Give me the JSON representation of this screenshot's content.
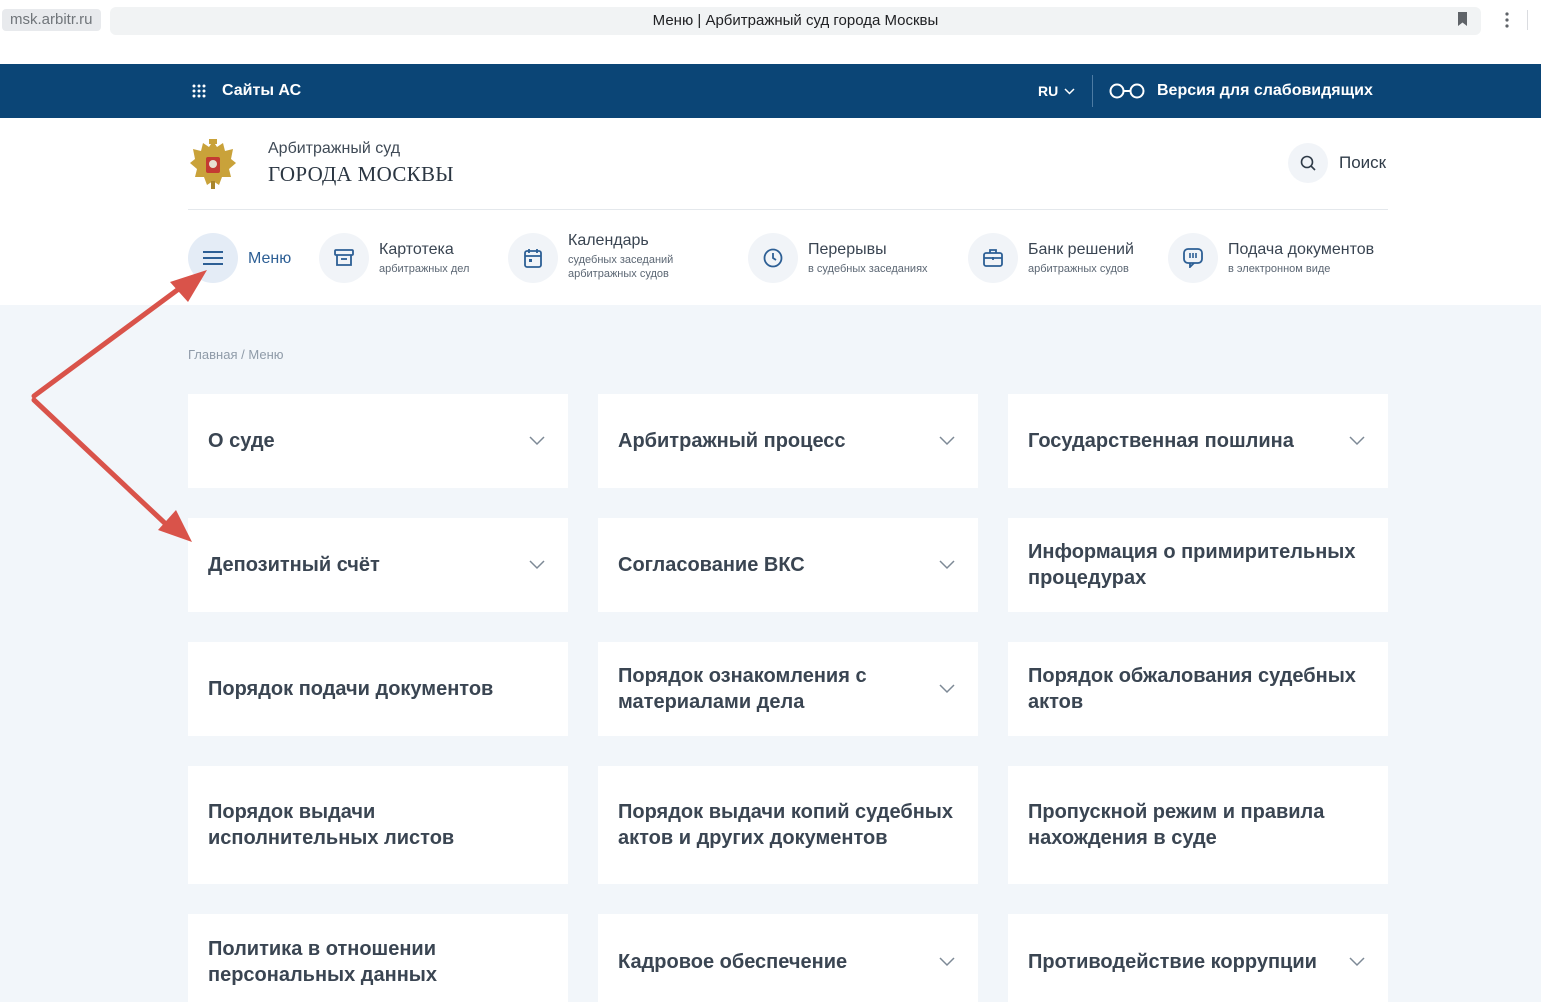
{
  "browser": {
    "url": "msk.arbitr.ru",
    "tab_title": "Меню | Арбитражный суд города Москвы"
  },
  "topbar": {
    "sites_label": "Сайты АС",
    "lang_label": "RU",
    "vision_label": "Версия для слабовидящих",
    "bg_color": "#0b4576"
  },
  "header": {
    "court_name": "Арбитражный суд",
    "court_city": "ГОРОДА МОСКВЫ",
    "search_label": "Поиск"
  },
  "nav": {
    "menu": {
      "title": "Меню",
      "icon": "hamburger-icon"
    },
    "kartoteka": {
      "title": "Картотека",
      "sub": "арбитражных дел",
      "icon": "archive-icon"
    },
    "calendar": {
      "title": "Календарь",
      "sub1": "судебных заседаний",
      "sub2": "арбитражных судов",
      "icon": "calendar-icon"
    },
    "breaks": {
      "title": "Перерывы",
      "sub": "в судебных заседаниях",
      "icon": "clock-icon"
    },
    "bank": {
      "title": "Банк решений",
      "sub": "арбитражных судов",
      "icon": "briefcase-icon"
    },
    "filing": {
      "title": "Подача документов",
      "sub": "в электронном виде",
      "icon": "chat-icon"
    }
  },
  "breadcrumb": {
    "home": "Главная",
    "separator": "/",
    "current": "Меню"
  },
  "cards": [
    {
      "label": "О суде",
      "expandable": true
    },
    {
      "label": "Арбитражный процесс",
      "expandable": true
    },
    {
      "label": "Государственная пошлина",
      "expandable": true
    },
    {
      "label": "Депозитный счёт",
      "expandable": true
    },
    {
      "label": "Согласование ВКС",
      "expandable": true
    },
    {
      "label": "Информация о примирительных процедурах",
      "expandable": false
    },
    {
      "label": "Порядок подачи документов",
      "expandable": false
    },
    {
      "label": "Порядок ознакомления с материалами дела",
      "expandable": true
    },
    {
      "label": "Порядок обжалования судебных актов",
      "expandable": false
    },
    {
      "label": "Порядок выдачи исполнительных листов",
      "expandable": false
    },
    {
      "label": "Порядок выдачи копий судебных актов и других документов",
      "expandable": false
    },
    {
      "label": "Пропускной режим и правила нахождения в суде",
      "expandable": false
    },
    {
      "label": "Политика в отношении персональных данных",
      "expandable": false
    },
    {
      "label": "Кадровое обеспечение",
      "expandable": true
    },
    {
      "label": "Противодействие коррупции",
      "expandable": true
    }
  ],
  "annotation": {
    "arrow_color": "#d9534a"
  }
}
